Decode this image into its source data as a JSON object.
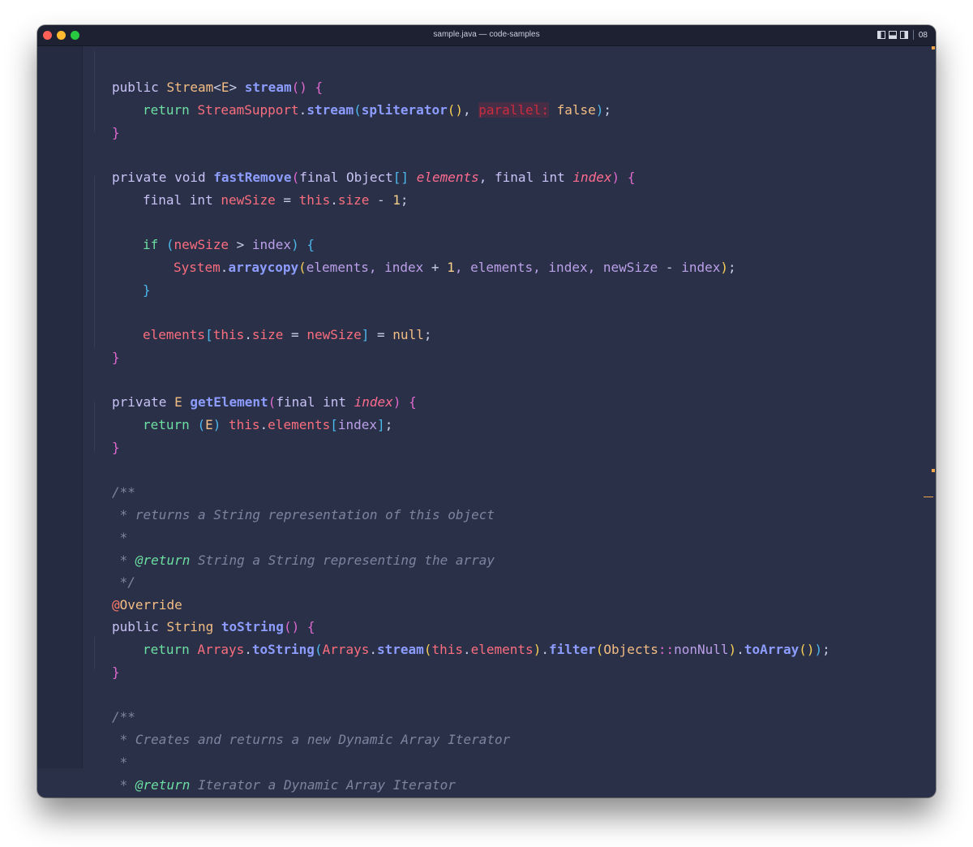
{
  "window": {
    "title": "sample.java — code-samples"
  },
  "titlebar": {
    "right_text": "08"
  },
  "theme": {
    "background": "#2a3048",
    "keyword": "#c8c2f5",
    "return_keyword": "#6cdfa2",
    "type": "#f3bd83",
    "function": "#8d9dff",
    "field": "#fa6e7e",
    "comment": "#7d849f",
    "scrollbar_marker": "#f0a54a"
  },
  "code": {
    "l1": {
      "t1": "public ",
      "t2": "Stream",
      "t3": "<",
      "t4": "E",
      "t5": "> ",
      "t6": "stream",
      "t7": "()",
      "t8": " ",
      "t9": "{"
    },
    "l2": {
      "t1": "return ",
      "t2": "StreamSupport",
      "t3": ".",
      "t4": "stream",
      "t5": "(",
      "t6": "spliterator",
      "t7": "()",
      "t8": ", ",
      "t9": "parallel:",
      "t10": " false",
      "t11": ")",
      "t12": ";"
    },
    "l3": {
      "t1": "}"
    },
    "l5": {
      "t1": "private void ",
      "t2": "fastRemove",
      "t3": "(",
      "t4": "final Object",
      "t5": "[]",
      "t6": " ",
      "t7": "elements",
      "t8": ", final int ",
      "t9": "index",
      "t10": ")",
      "t11": " ",
      "t12": "{"
    },
    "l6": {
      "t1": "final int ",
      "t2": "newSize",
      "t3": " = ",
      "t4": "this",
      "t5": ".",
      "t6": "size",
      "t7": " - ",
      "t8": "1",
      "t9": ";"
    },
    "l8": {
      "t1": "if ",
      "t2": "(",
      "t3": "newSize",
      "t4": " > ",
      "t5": "index",
      "t6": ")",
      "t7": " ",
      "t8": "{"
    },
    "l9": {
      "t1": "System",
      "t2": ".",
      "t3": "arraycopy",
      "t4": "(",
      "t5": "elements, index",
      "t6": " + ",
      "t7": "1",
      "t8": ", elements, index, newSize",
      "t9": " - ",
      "t10": "index",
      "t11": ")",
      "t12": ";"
    },
    "l10": {
      "t1": "}"
    },
    "l12": {
      "t1": "elements",
      "t2": "[",
      "t3": "this",
      "t4": ".",
      "t5": "size",
      "t6": " = ",
      "t7": "newSize",
      "t8": "]",
      "t9": " = ",
      "t10": "null",
      "t11": ";"
    },
    "l13": {
      "t1": "}"
    },
    "l15": {
      "t1": "private ",
      "t2": "E",
      "t3": " ",
      "t4": "getElement",
      "t5": "(",
      "t6": "final int ",
      "t7": "index",
      "t8": ")",
      "t9": " ",
      "t10": "{"
    },
    "l16": {
      "t1": "return ",
      "t2": "(",
      "t3": "E",
      "t4": ")",
      "t5": " ",
      "t6": "this",
      "t7": ".",
      "t8": "elements",
      "t9": "[",
      "t10": "index",
      "t11": "]",
      "t12": ";"
    },
    "l17": {
      "t1": "}"
    },
    "l19": {
      "t1": "/**"
    },
    "l20": {
      "t1": " * returns a String representation of this object"
    },
    "l21": {
      "t1": " *"
    },
    "l22": {
      "t1": " * ",
      "t2": "@return",
      "t3": " String a String representing the array"
    },
    "l23": {
      "t1": " */"
    },
    "l24": {
      "t1": "@",
      "t2": "Override"
    },
    "l25": {
      "t1": "public ",
      "t2": "String",
      "t3": " ",
      "t4": "toString",
      "t5": "()",
      "t6": " ",
      "t7": "{"
    },
    "l26": {
      "t1": "return ",
      "t2": "Arrays",
      "t3": ".",
      "t4": "toString",
      "t5": "(",
      "t6": "Arrays",
      "t7": ".",
      "t8": "stream",
      "t9": "(",
      "t10": "this",
      "t11": ".",
      "t12": "elements",
      "t13": ")",
      "t14": ".",
      "t15": "filter",
      "t16": "(",
      "t17": "Objects",
      "t18": "::",
      "t19": "nonNull",
      "t20": ")",
      "t21": ".",
      "t22": "toArray",
      "t23": "()",
      "t24": ")",
      "t25": ";"
    },
    "l27": {
      "t1": "}"
    },
    "l29": {
      "t1": "/**"
    },
    "l30": {
      "t1": " * Creates and returns a new Dynamic Array Iterator"
    },
    "l31": {
      "t1": " *"
    },
    "l32": {
      "t1": " * ",
      "t2": "@return",
      "t3": " Iterator a Dynamic Array Iterator"
    }
  }
}
